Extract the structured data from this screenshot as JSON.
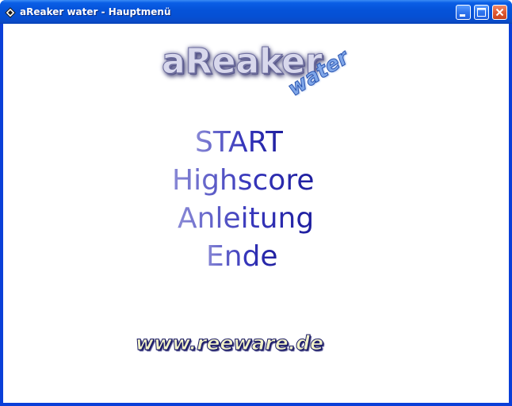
{
  "window": {
    "title": "aReaker water - Hauptmenü",
    "icons": {
      "app": "diamond-app-icon",
      "minimize": "minimize-icon",
      "maximize": "maximize-icon",
      "close": "close-icon"
    }
  },
  "logo": {
    "main": "aReaker",
    "sub": "water"
  },
  "menu": {
    "items": [
      {
        "label": "START"
      },
      {
        "label": "Highscore"
      },
      {
        "label": "Anleitung"
      },
      {
        "label": "Ende"
      }
    ]
  },
  "footer": {
    "website": "www.reeware.de"
  },
  "colors": {
    "titlebar": "#0553d9",
    "menu_text": "#2c2cb0",
    "close_button": "#e05a32"
  }
}
